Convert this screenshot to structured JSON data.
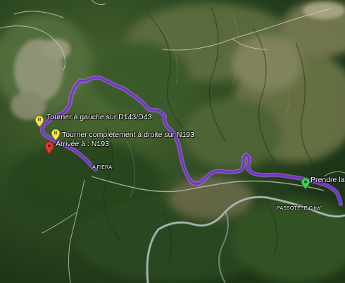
{
  "map": {
    "colors": {
      "route": "#7a2fd6",
      "route_glow": "#b07cff",
      "river": "#9fb0a8",
      "road": "#d8d2c4"
    },
    "markers": [
      {
        "id": "turn-left",
        "label": "Tourner à gauche sur D143/D43",
        "icon": "yellow-instruction-pin"
      },
      {
        "id": "turn-right",
        "label": "Tourner complètement à droite sur N193",
        "icon": "yellow-instruction-pin"
      },
      {
        "id": "arrival",
        "label": "Arrivée à :  N193",
        "icon": "red-destination-pin"
      },
      {
        "id": "start",
        "label": "Prendre la",
        "icon": "green-start-pin"
      }
    ],
    "places": [
      {
        "id": "a-fiera",
        "label": "A FIERA"
      },
      {
        "id": "passerelle",
        "label": "PASSOTE \"E Citta\""
      }
    ]
  }
}
